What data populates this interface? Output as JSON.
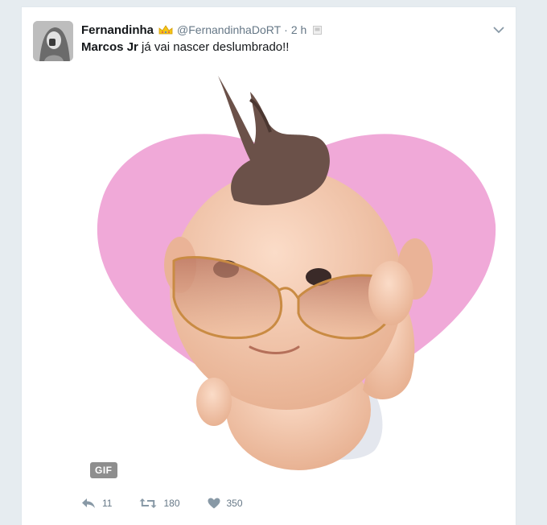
{
  "tweet": {
    "display_name": "Fernandinha",
    "handle": "@FernandinhaDoRT",
    "separator": "·",
    "time": "2 h",
    "text_bold": "Marcos Jr",
    "text_rest": " já vai nascer deslumbrado!!",
    "media_badge": "GIF"
  },
  "actions": {
    "reply_count": "11",
    "retweet_count": "180",
    "like_count": "350"
  },
  "icons": {
    "badge": "crown-emoji-icon",
    "report": "flag-icon",
    "menu": "chevron-down-icon",
    "reply": "reply-icon",
    "retweet": "retweet-icon",
    "like": "heart-icon"
  },
  "colors": {
    "text": "#14171a",
    "secondary": "#657786",
    "heart_shape": "#f0a9d8",
    "background": "#e6ecf0"
  }
}
